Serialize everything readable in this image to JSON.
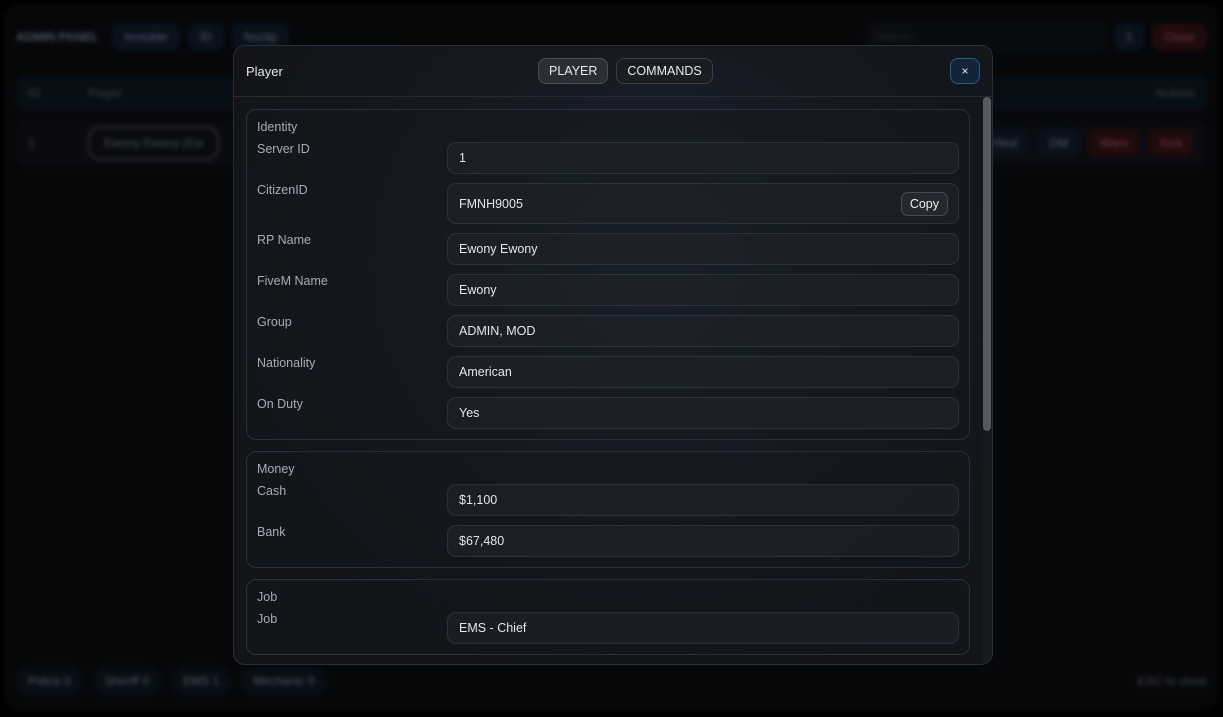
{
  "background": {
    "title": "ADMIN PANEL",
    "toggles": [
      "Invisible",
      "ID",
      "Noclip"
    ],
    "search_placeholder": "Search",
    "count": "1",
    "close_label": "Close",
    "table_headers": {
      "id": "ID",
      "player": "Player",
      "actions": "Actions"
    },
    "row": {
      "id": "1",
      "player": "Ewony Ewony (Ew",
      "actions": [
        "Heal",
        "DM",
        "Warn",
        "Kick"
      ]
    },
    "jobs": [
      {
        "label": "Police",
        "count": "0"
      },
      {
        "label": "Sheriff",
        "count": "0"
      },
      {
        "label": "EMS",
        "count": "1"
      },
      {
        "label": "Mechanic",
        "count": "0"
      }
    ],
    "hint": "ESC to close"
  },
  "modal": {
    "title": "Player",
    "tabs": [
      "PLAYER",
      "COMMANDS"
    ],
    "close_label": "×",
    "copy_label": "Copy",
    "identity": {
      "title": "Identity",
      "fields": [
        {
          "label": "Server ID",
          "value": "1"
        },
        {
          "label": "CitizenID",
          "value": "FMNH9005"
        },
        {
          "label": "RP Name",
          "value": "Ewony Ewony"
        },
        {
          "label": "FiveM Name",
          "value": "Ewony"
        },
        {
          "label": "Group",
          "value": "ADMIN, MOD"
        },
        {
          "label": "Nationality",
          "value": "American"
        },
        {
          "label": "On Duty",
          "value": "Yes"
        }
      ]
    },
    "money": {
      "title": "Money",
      "fields": [
        {
          "label": "Cash",
          "value": "$1,100"
        },
        {
          "label": "Bank",
          "value": "$67,480"
        }
      ]
    },
    "job": {
      "title": "Job",
      "fields": [
        {
          "label": "Job",
          "value": "EMS - Chief"
        }
      ]
    }
  }
}
